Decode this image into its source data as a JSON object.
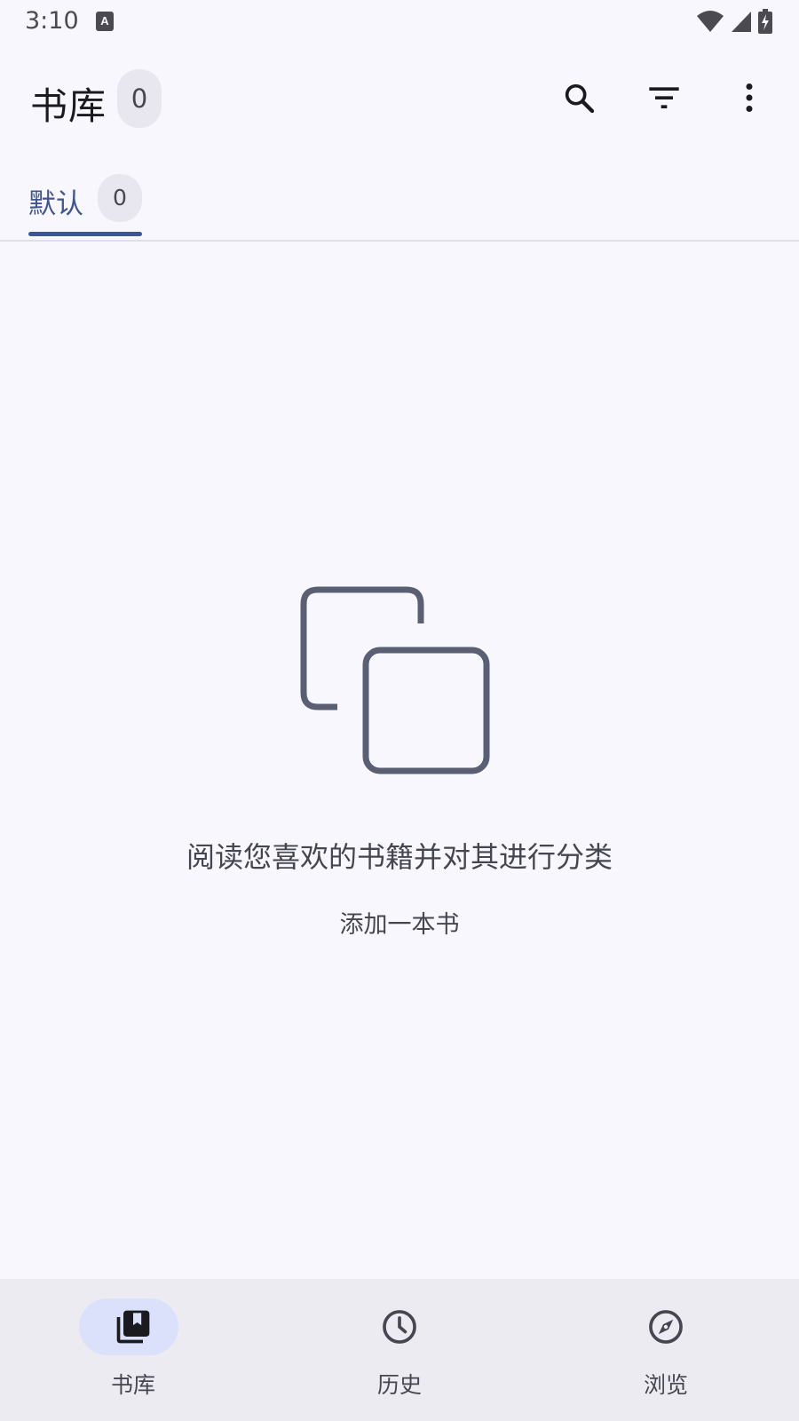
{
  "status_bar": {
    "time": "3:10",
    "icons": [
      "a-notification-icon",
      "wifi-icon",
      "signal-icon",
      "battery-charging-icon"
    ]
  },
  "top_bar": {
    "title": "书库",
    "count": "0",
    "actions": [
      "search-icon",
      "filter-icon",
      "more-vert-icon"
    ]
  },
  "tabs": [
    {
      "label": "默认",
      "count": "0",
      "selected": true
    }
  ],
  "empty_state": {
    "icon": "copy-icon",
    "message": "阅读您喜欢的书籍并对其进行分类",
    "action_label": "添加一本书"
  },
  "bottom_nav": {
    "items": [
      {
        "label": "书库",
        "icon": "library-icon",
        "selected": true
      },
      {
        "label": "历史",
        "icon": "history-icon",
        "selected": false
      },
      {
        "label": "浏览",
        "icon": "explore-icon",
        "selected": false
      }
    ]
  },
  "colors": {
    "accent": "#3f5590",
    "background": "#f8f7fd",
    "nav_background": "#ecebf2",
    "nav_pill": "#dbe1fb",
    "icon": "#45464f"
  }
}
